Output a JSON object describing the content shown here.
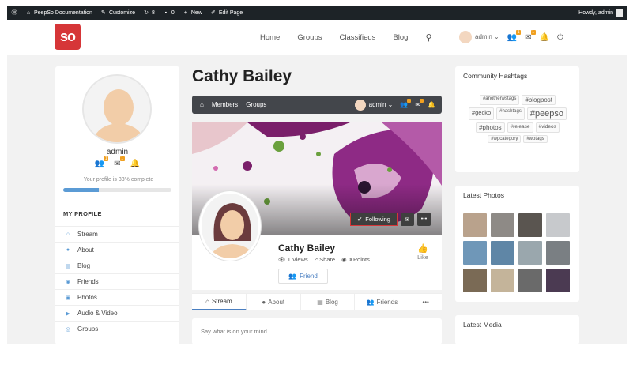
{
  "adminbar": {
    "site_name": "PeepSo Documentation",
    "customize": "Customize",
    "comments_count": "8",
    "pending_count": "0",
    "new_label": "New",
    "edit_page": "Edit Page",
    "howdy": "Howdy, admin"
  },
  "header": {
    "logo_text": "so",
    "nav": [
      "Home",
      "Groups",
      "Classifieds",
      "Blog"
    ],
    "user_name": "admin",
    "friend_badge": "1",
    "message_badge": "1"
  },
  "left": {
    "user_name": "admin",
    "friend_badge": "1",
    "message_badge": "1",
    "profile_complete_text": "Your profile is 33% complete",
    "profile_complete_value": 0.33,
    "my_profile_heading": "MY PROFILE",
    "menu": [
      {
        "icon": "stream-icon",
        "glyph": "⌂",
        "label": "Stream"
      },
      {
        "icon": "user-icon",
        "glyph": "●",
        "label": "About"
      },
      {
        "icon": "blog-icon",
        "glyph": "▤",
        "label": "Blog"
      },
      {
        "icon": "friends-icon",
        "glyph": "◉",
        "label": "Friends"
      },
      {
        "icon": "photos-icon",
        "glyph": "▣",
        "label": "Photos"
      },
      {
        "icon": "video-icon",
        "glyph": "▶",
        "label": "Audio & Video"
      },
      {
        "icon": "groups-icon",
        "glyph": "◎",
        "label": "Groups"
      }
    ]
  },
  "main": {
    "title": "Cathy Bailey",
    "subnav": {
      "members": "Members",
      "groups": "Groups",
      "user_name": "admin"
    },
    "following_label": "Following",
    "profile": {
      "name": "Cathy Bailey",
      "views": "1 Views",
      "share": "Share",
      "points_value": "0",
      "points_label": "Points",
      "like_label": "Like",
      "friend_label": "Friend"
    },
    "tabs": [
      "Stream",
      "About",
      "Blog",
      "Friends"
    ],
    "post_placeholder": "Say what is on your mind..."
  },
  "right": {
    "hashtags_heading": "Community Hashtags",
    "hashtags": [
      {
        "text": "#anotherwstags",
        "size": 6
      },
      {
        "text": "#blogpost",
        "size": 8
      },
      {
        "text": "#gecko",
        "size": 7.5
      },
      {
        "text": "#hashtags",
        "size": 6
      },
      {
        "text": "#peepso",
        "size": 11
      },
      {
        "text": "#photos",
        "size": 8
      },
      {
        "text": "#release",
        "size": 6.5
      },
      {
        "text": "#videos",
        "size": 6.5
      },
      {
        "text": "#wpcategory",
        "size": 6
      },
      {
        "text": "#wptags",
        "size": 6
      }
    ],
    "photos_heading": "Latest Photos",
    "media_heading": "Latest Media",
    "photo_colors": [
      "#b9a28c",
      "#8e8a86",
      "#5a5550",
      "#c7c9cc",
      "#6f97b8",
      "#5f86a6",
      "#9aa7ad",
      "#7a7f83",
      "#7a6a55",
      "#c4b49a",
      "#6a6a6a",
      "#4b3a52"
    ]
  },
  "colors": {
    "accent": "#5b9bd5",
    "brand": "#d63638",
    "admin_bar": "#1d2327",
    "badge": "#f0a020"
  }
}
